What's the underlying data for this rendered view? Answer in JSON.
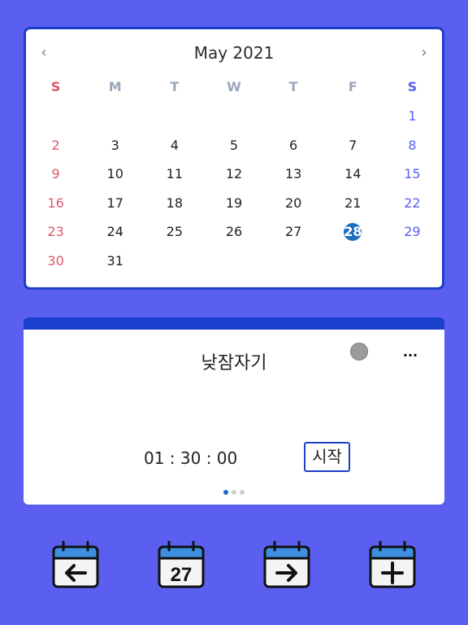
{
  "calendar": {
    "title": "May 2021",
    "prev_icon": "chevron-left-icon",
    "next_icon": "chevron-right-icon",
    "prev_glyph": "‹",
    "next_glyph": "›",
    "weekdays": [
      "S",
      "M",
      "T",
      "W",
      "T",
      "F",
      "S"
    ],
    "weeks": [
      [
        "",
        "",
        "",
        "",
        "",
        "",
        "1"
      ],
      [
        "2",
        "3",
        "4",
        "5",
        "6",
        "7",
        "8"
      ],
      [
        "9",
        "10",
        "11",
        "12",
        "13",
        "14",
        "15"
      ],
      [
        "16",
        "17",
        "18",
        "19",
        "20",
        "21",
        "22"
      ],
      [
        "23",
        "24",
        "25",
        "26",
        "27",
        "28",
        "29"
      ],
      [
        "30",
        "31",
        "",
        "",
        "",
        "",
        ""
      ]
    ],
    "today": "28",
    "colors": {
      "sunday": "#e0556a",
      "saturday": "#5a5ff0",
      "today_bg": "#1e6ec0",
      "border": "#1e3fc8"
    }
  },
  "timer": {
    "title": "낮잠자기",
    "time": "01 : 30 : 00",
    "start_label": "시작",
    "more_label": "···",
    "pager_count": 3,
    "pager_active": 0
  },
  "toolbar": {
    "buttons": [
      {
        "name": "previous-day-button",
        "icon": "calendar-arrow-left-icon"
      },
      {
        "name": "today-button",
        "icon": "calendar-today-icon",
        "label": "27"
      },
      {
        "name": "next-day-button",
        "icon": "calendar-arrow-right-icon"
      },
      {
        "name": "add-event-button",
        "icon": "calendar-plus-icon"
      }
    ]
  },
  "colors": {
    "background": "#5a5ff0",
    "accent": "#1a3fcc",
    "icon_blue": "#3d8fe0"
  }
}
